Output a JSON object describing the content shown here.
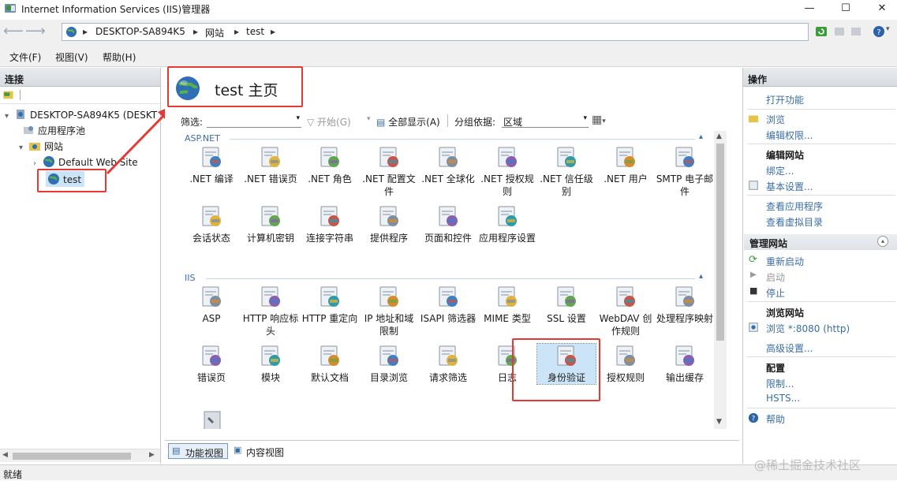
{
  "window": {
    "title": "Internet Information Services (IIS)管理器",
    "min": "—",
    "max": "☐",
    "close": "✕"
  },
  "address": {
    "crumbs": [
      "DESKTOP-SA894K5",
      "网站",
      "test"
    ],
    "sep": "▸"
  },
  "menu": [
    "文件(F)",
    "视图(V)",
    "帮助(H)"
  ],
  "left": {
    "header": "连接",
    "tree": [
      {
        "label": "DESKTOP-SA894K5 (DESKT",
        "glyph": "▾"
      },
      {
        "label": "应用程序池",
        "glyph": ""
      },
      {
        "label": "网站",
        "glyph": "▾"
      },
      {
        "label": "Default Web Site",
        "glyph": "›"
      },
      {
        "label": "test",
        "glyph": ""
      }
    ]
  },
  "center": {
    "page_title": "test 主页",
    "filter_label": "筛选:",
    "start_label": "开始(G)",
    "showall_label": "全部显示(A)",
    "group_label": "分组依据:",
    "group_value": "区域",
    "group_aspnet": "ASP.NET",
    "group_iis": "IIS",
    "aspnet_items": [
      ".NET 编译",
      ".NET 错误页",
      ".NET 角色",
      ".NET 配置文件",
      ".NET 全球化",
      ".NET 授权规则",
      ".NET 信任级别",
      ".NET 用户",
      "SMTP 电子邮件",
      "会话状态",
      "计算机密钥",
      "连接字符串",
      "提供程序",
      "页面和控件",
      "应用程序设置"
    ],
    "iis_items": [
      "ASP",
      "HTTP 响应标头",
      "HTTP 重定向",
      "IP 地址和域限制",
      "ISAPI 筛选器",
      "MIME 类型",
      "SSL 设置",
      "WebDAV 创作规则",
      "处理程序映射",
      "错误页",
      "模块",
      "默认文档",
      "目录浏览",
      "请求筛选",
      "日志",
      "身份验证",
      "授权规则",
      "输出缓存"
    ],
    "tab_features": "功能视图",
    "tab_content": "内容视图"
  },
  "right": {
    "header": "操作",
    "open_feature": "打开功能",
    "browse": "浏览",
    "edit_perm": "编辑权限...",
    "edit_site": "编辑网站",
    "bindings": "绑定...",
    "basic": "基本设置...",
    "view_apps": "查看应用程序",
    "view_vdirs": "查看虚拟目录",
    "manage_site": "管理网站",
    "restart": "重新启动",
    "start": "启动",
    "stop": "停止",
    "browse_site": "浏览网站",
    "browse_port": "浏览 *:8080 (http)",
    "advanced": "高级设置...",
    "config": "配置",
    "limits": "限制...",
    "hsts": "HSTS...",
    "help": "帮助"
  },
  "status": {
    "text": "就绪",
    "watermark": "@稀土掘金技术社区"
  },
  "colors": {
    "accent": "#3a6ea5",
    "highlight_box": "#e53935",
    "selected_item_bg": "#cce4f7"
  }
}
